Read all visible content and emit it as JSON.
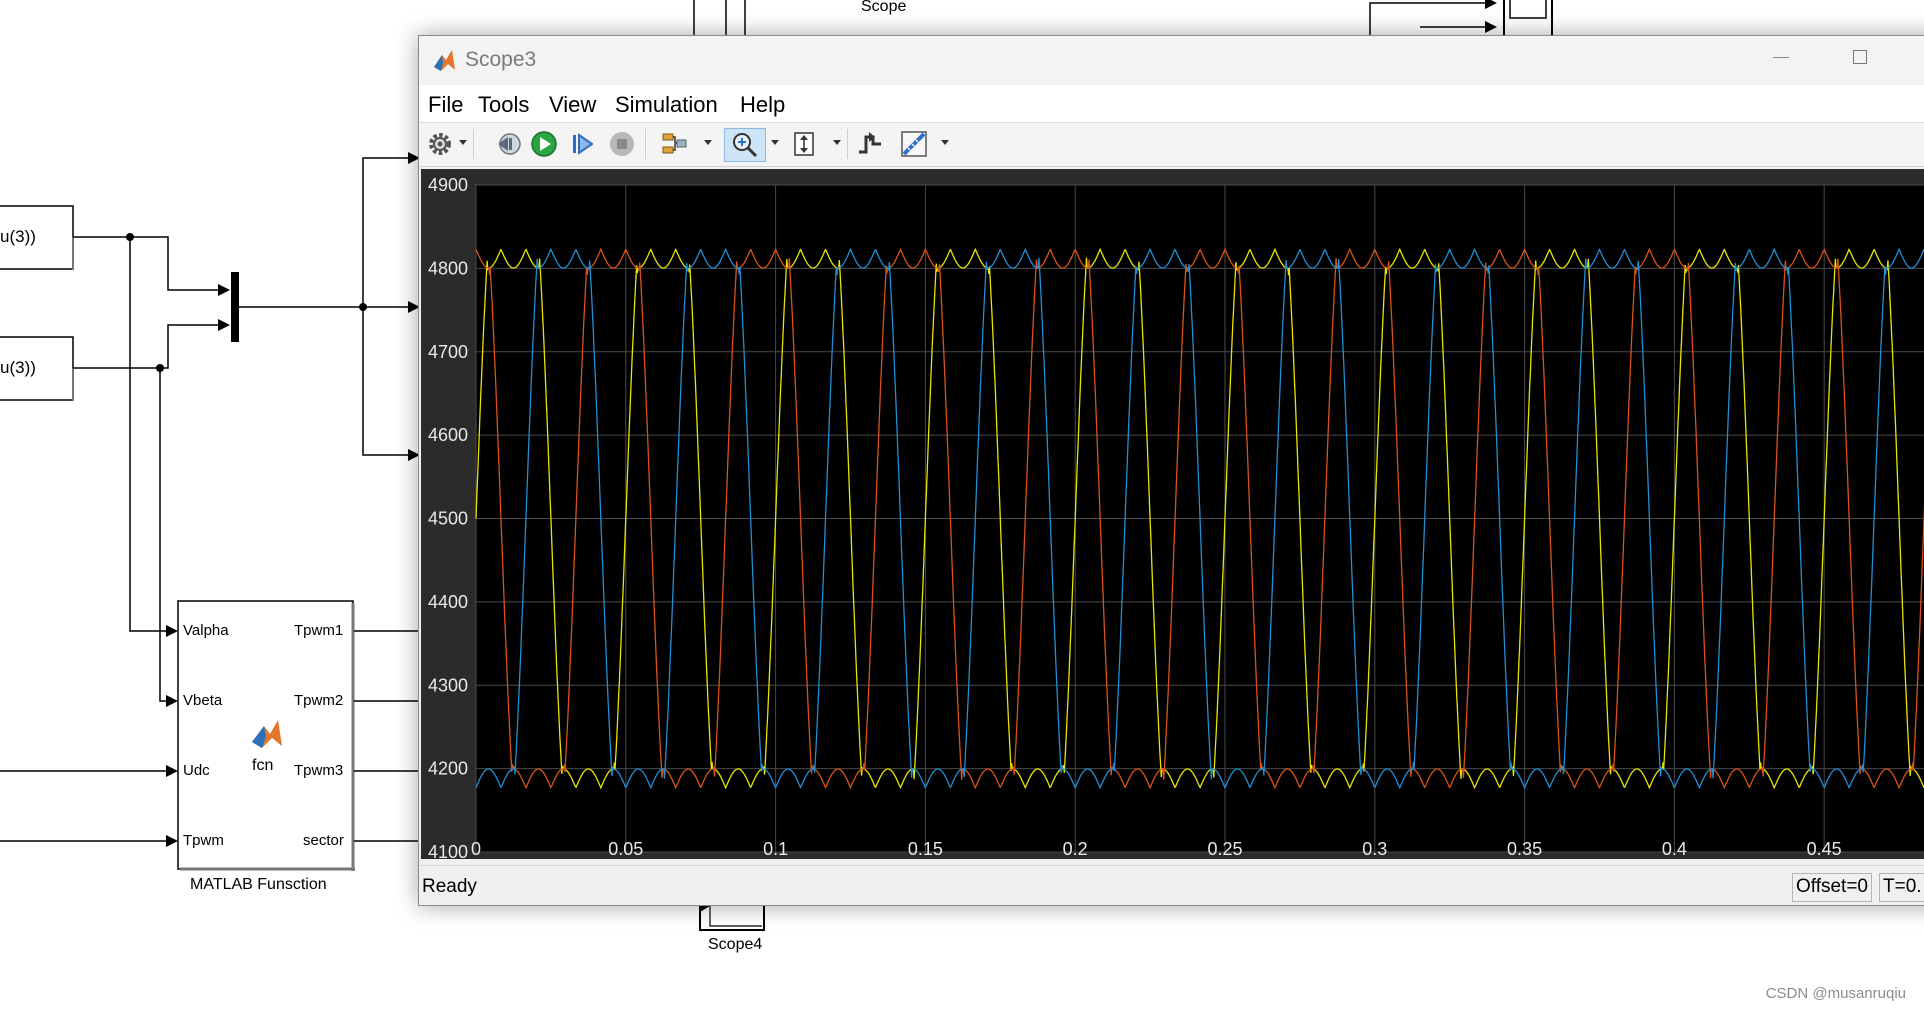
{
  "diagram": {
    "fcn_block_1_text": "u(3))",
    "fcn_block_2_text": "u(3))",
    "matlab_fn": {
      "inputs": [
        "Valpha",
        "Vbeta",
        "Udc",
        "Tpwm"
      ],
      "outputs": [
        "Tpwm1",
        "Tpwm2",
        "Tpwm3",
        "sector"
      ],
      "center_label": "fcn",
      "block_title": "MATLAB Funsction"
    },
    "scope_label": "Scope",
    "scope4_label": "Scope4"
  },
  "window": {
    "title": "Scope3",
    "controls": {
      "minimize": "—",
      "maximize": "☐",
      "close": "✕"
    }
  },
  "menu": [
    "File",
    "Tools",
    "View",
    "Simulation",
    "Help"
  ],
  "toolbar": {
    "icons": [
      "settings-icon",
      "step-back-icon",
      "run-icon",
      "step-forward-icon",
      "stop-icon",
      "signal-selector-icon",
      "zoom-in-icon",
      "autoscale-icon",
      "triggers-icon",
      "measurements-icon"
    ]
  },
  "status": {
    "text": "Ready",
    "offset": "Offset=0",
    "time": "T=0."
  },
  "watermark": "CSDN @musanruqiu",
  "chart_data": {
    "type": "line",
    "title": "",
    "xlabel": "",
    "ylabel": "",
    "xlim": [
      0,
      0.495
    ],
    "ylim": [
      4100,
      4900
    ],
    "xticks": [
      "0",
      "0.05",
      "0.1",
      "0.15",
      "0.2",
      "0.25",
      "0.3",
      "0.35",
      "0.4",
      "0.45"
    ],
    "yticks": [
      "4100",
      "4200",
      "4300",
      "4400",
      "4500",
      "4600",
      "4700",
      "4800",
      "4900"
    ],
    "grid": true,
    "background": "#000000",
    "period": 0.05,
    "series": [
      {
        "color": "#e8e600",
        "phase_offset_deg": 0,
        "value_at_0": 4500,
        "max": 4823,
        "min": 4177
      },
      {
        "color": "#d95319",
        "phase_offset_deg": 120,
        "value_at_0": 4823,
        "max": 4823,
        "min": 4177
      },
      {
        "color": "#1f8fd6",
        "phase_offset_deg": 240,
        "value_at_0": 4177,
        "max": 4823,
        "min": 4177
      }
    ]
  }
}
